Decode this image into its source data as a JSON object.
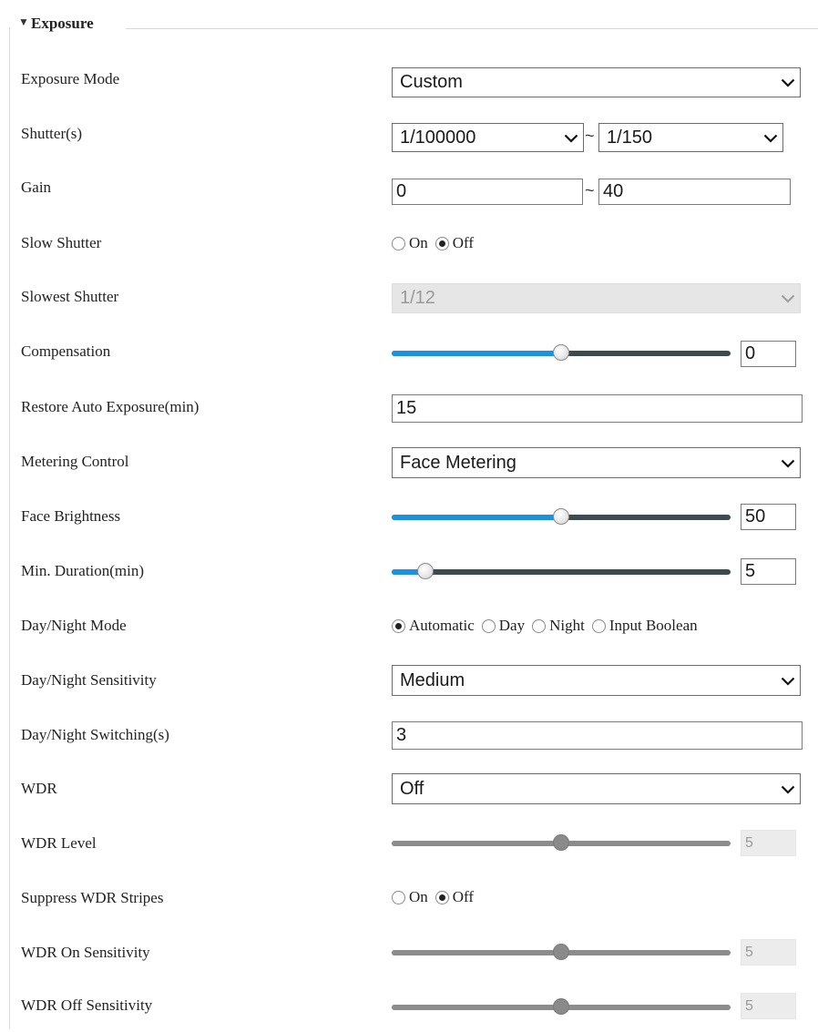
{
  "section": {
    "title": "Exposure",
    "toggle_icon": "triangle-down-icon"
  },
  "exposure_mode": {
    "label": "Exposure Mode",
    "value": "Custom"
  },
  "shutter": {
    "label": "Shutter(s)",
    "min": "1/100000",
    "separator": "~",
    "max": "1/150"
  },
  "gain": {
    "label": "Gain",
    "min": "0",
    "separator": "~",
    "max": "40"
  },
  "slow_shutter": {
    "label": "Slow Shutter",
    "options": [
      "On",
      "Off"
    ],
    "selected": "Off"
  },
  "slowest_shutter": {
    "label": "Slowest Shutter",
    "value": "1/12",
    "disabled": true
  },
  "compensation": {
    "label": "Compensation",
    "value": "0",
    "fraction": 0.5
  },
  "restore_auto_exposure": {
    "label": "Restore Auto Exposure(min)",
    "value": "15"
  },
  "metering_control": {
    "label": "Metering Control",
    "value": "Face Metering"
  },
  "face_brightness": {
    "label": "Face Brightness",
    "value": "50",
    "fraction": 0.5
  },
  "min_duration": {
    "label": "Min. Duration(min)",
    "value": "5",
    "fraction": 0.1
  },
  "day_night_mode": {
    "label": "Day/Night Mode",
    "options": [
      "Automatic",
      "Day",
      "Night",
      "Input Boolean"
    ],
    "selected": "Automatic"
  },
  "day_night_sensitivity": {
    "label": "Day/Night Sensitivity",
    "value": "Medium"
  },
  "day_night_switching": {
    "label": "Day/Night Switching(s)",
    "value": "3"
  },
  "wdr": {
    "label": "WDR",
    "value": "Off"
  },
  "wdr_level": {
    "label": "WDR Level",
    "value": "5",
    "fraction": 0.5,
    "disabled": true
  },
  "suppress_wdr_stripes": {
    "label": "Suppress WDR Stripes",
    "options": [
      "On",
      "Off"
    ],
    "selected": "Off"
  },
  "wdr_on_sensitivity": {
    "label": "WDR On Sensitivity",
    "value": "5",
    "fraction": 0.5,
    "disabled": true
  },
  "wdr_off_sensitivity": {
    "label": "WDR Off Sensitivity",
    "value": "5",
    "fraction": 0.5,
    "disabled": true
  },
  "colors": {
    "slider_fill": "#1e90e0",
    "slider_track": "#3d4a52",
    "disabled_gray": "#8c8c8c"
  }
}
